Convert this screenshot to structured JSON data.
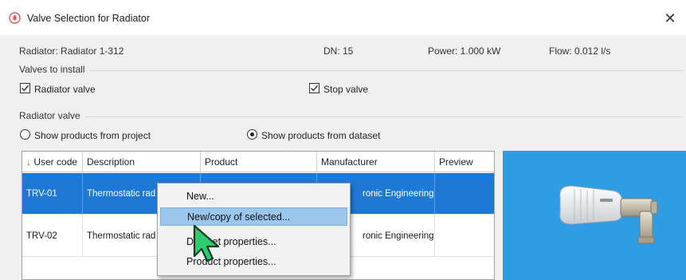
{
  "window": {
    "title": "Valve Selection for Radiator",
    "close_symbol": "✕"
  },
  "info": {
    "radiator": "Radiator: Radiator 1-312",
    "dn": "DN: 15",
    "power": "Power: 1.000 kW",
    "flow": "Flow: 0.012 l/s"
  },
  "valves_to_install": {
    "label": "Valves to install",
    "radiator_valve": {
      "label": "Radiator valve",
      "checked": true
    },
    "stop_valve": {
      "label": "Stop valve",
      "checked": true
    }
  },
  "radiator_valve_group": {
    "label": "Radiator valve",
    "options": [
      {
        "label": "Show products from project",
        "selected": false
      },
      {
        "label": "Show products from dataset",
        "selected": true
      }
    ]
  },
  "table": {
    "sort_arrow": "↓",
    "columns": [
      "User code",
      "Description",
      "Product",
      "Manufacturer",
      "Preview"
    ],
    "rows": [
      {
        "user_code": "TRV-01",
        "description": "Thermostatic rad",
        "product": "",
        "manufacturer": "ronic Engineering",
        "selected": true
      },
      {
        "user_code": "TRV-02",
        "description": "Thermostatic rad",
        "product": "",
        "manufacturer": "ronic Engineering",
        "selected": false
      }
    ]
  },
  "context_menu": {
    "items": [
      {
        "label": "New...",
        "hover": false
      },
      {
        "label": "New/copy of selected...",
        "hover": true
      },
      {
        "label": "Dataset properties...",
        "hover": false
      },
      {
        "label": "Product properties...",
        "hover": false
      }
    ]
  },
  "colors": {
    "selection": "#1e79d6",
    "preview_bg": "#2f9de6",
    "menu_hover": "#9bc7ef",
    "cursor": "#2ecc71"
  },
  "icons": {
    "title": "radiator-app-icon",
    "cursor": "pointer-arrow-icon",
    "preview": "thermostatic-valve-image"
  }
}
